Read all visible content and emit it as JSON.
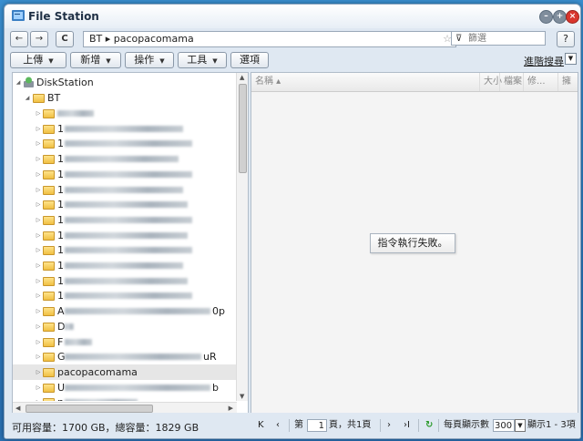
{
  "window": {
    "title": "File Station"
  },
  "nav": {
    "back": "←",
    "forward": "→",
    "refresh": "C",
    "path": "BT ▸ pacopacomama",
    "search_placeholder": "篩選",
    "help": "?"
  },
  "toolbar": {
    "upload": "上傳",
    "create": "新增",
    "action": "操作",
    "tools": "工具",
    "settings": "選項",
    "advanced_search": "進階搜尋"
  },
  "tree": {
    "root": "DiskStation",
    "folder": "BT",
    "items": [
      "",
      "1",
      "1",
      "1",
      "1",
      "1",
      "1",
      "1",
      "1",
      "1",
      "1",
      "1",
      "1",
      "A",
      "D",
      "F",
      "G",
      "pacopacomama",
      "U",
      "n"
    ],
    "item_tails": [
      "",
      "",
      "",
      "",
      "",
      "",
      "",
      "",
      "",
      "",
      "",
      "",
      "",
      "0p",
      "",
      "",
      "uR",
      "",
      "b",
      ""
    ]
  },
  "columns": {
    "name": "名稱 ▴",
    "size": "大小",
    "type": "檔案",
    "modified": "修...",
    "extra": "擁"
  },
  "message": "指令執行失敗。",
  "status": {
    "capacity": "可用容量：1700 GB，總容量：1829 GB",
    "page_prefix": "第",
    "page_value": "1",
    "page_suffix": "頁，共1頁",
    "per_page_label": "每頁顯示數",
    "per_page_value": "300",
    "display_range": "顯示1 - 3項"
  }
}
